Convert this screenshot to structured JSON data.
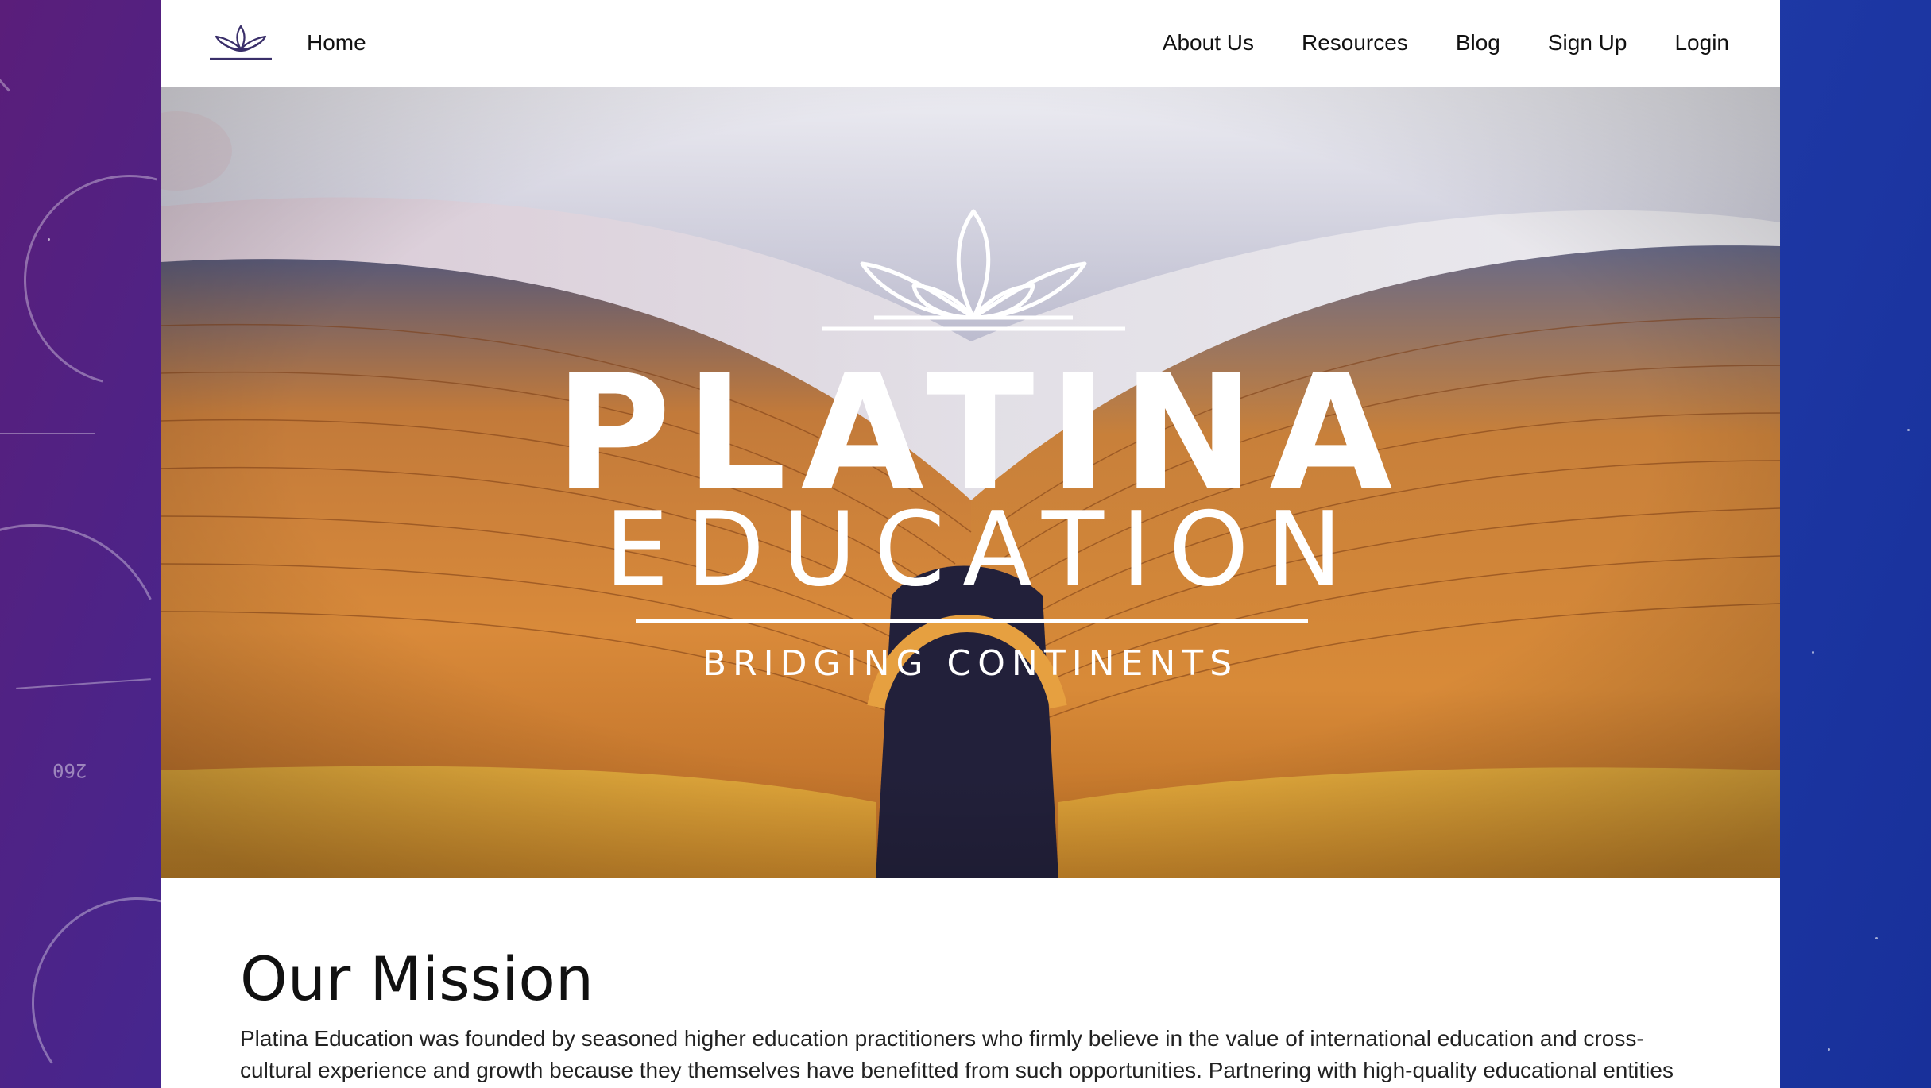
{
  "nav": {
    "home": "Home",
    "links": [
      "About Us",
      "Resources",
      "Blog",
      "Sign Up",
      "Login"
    ]
  },
  "hero": {
    "title": "PLATINA",
    "subtitle": "EDUCATION",
    "tagline": "BRIDGING CONTINENTS"
  },
  "mission": {
    "heading": "Our Mission",
    "body": "Platina Education was founded by seasoned higher education practitioners who firmly believe in the value of international education and cross-cultural experience and growth because they themselves have benefitted from such opportunities. Partnering with high-quality educational entities"
  },
  "backdrop": {
    "gauge_number": "260"
  },
  "colors": {
    "backdrop_left": "#5a1e7a",
    "backdrop_right": "#18309a",
    "logo_stroke": "#3a2f6a",
    "page_bg": "#ffffff"
  },
  "icons": {
    "nav_logo": "lotus-icon",
    "hero_logo": "lotus-icon"
  }
}
